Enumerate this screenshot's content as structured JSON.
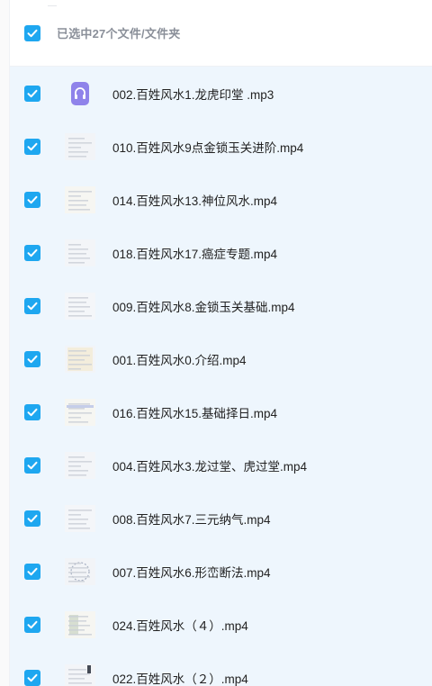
{
  "header": {
    "select_all_checked": true,
    "selection_label": "已选中27个文件/文件夹"
  },
  "files": [
    {
      "name": "002.百姓风水1.龙虎印堂 .mp3",
      "type": "audio",
      "checked": true,
      "icon": "audio-file-icon"
    },
    {
      "name": "010.百姓风水9点金锁玉关进阶.mp4",
      "type": "video",
      "checked": true,
      "icon": "video-thumbnail"
    },
    {
      "name": "014.百姓风水13.神位风水.mp4",
      "type": "video",
      "checked": true,
      "icon": "video-thumbnail"
    },
    {
      "name": "018.百姓风水17.癌症专题.mp4",
      "type": "video",
      "checked": true,
      "icon": "video-thumbnail"
    },
    {
      "name": "009.百姓风水8.金锁玉关基础.mp4",
      "type": "video",
      "checked": true,
      "icon": "video-thumbnail"
    },
    {
      "name": "001.百姓风水0.介绍.mp4",
      "type": "video",
      "checked": true,
      "icon": "video-thumbnail"
    },
    {
      "name": "016.百姓风水15.基础择日.mp4",
      "type": "video",
      "checked": true,
      "icon": "video-thumbnail"
    },
    {
      "name": "004.百姓风水3.龙过堂、虎过堂.mp4",
      "type": "video",
      "checked": true,
      "icon": "video-thumbnail"
    },
    {
      "name": "008.百姓风水7.三元纳气.mp4",
      "type": "video",
      "checked": true,
      "icon": "video-thumbnail"
    },
    {
      "name": "007.百姓风水6.形峦断法.mp4",
      "type": "video",
      "checked": true,
      "icon": "video-thumbnail"
    },
    {
      "name": "024.百姓风水（４）.mp4",
      "type": "video",
      "checked": true,
      "icon": "video-thumbnail"
    },
    {
      "name": "022.百姓风水（２）.mp4",
      "type": "video",
      "checked": true,
      "icon": "video-thumbnail"
    }
  ],
  "colors": {
    "accent": "#1ea7f0",
    "selected_row_bg": "#eef6fd",
    "audio_icon": "#8f83ea"
  }
}
